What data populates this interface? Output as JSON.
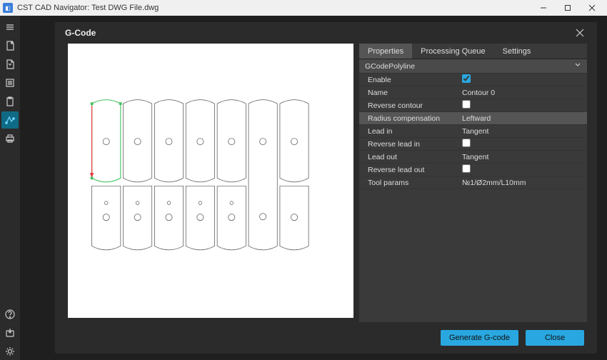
{
  "window": {
    "title": "CST CAD Navigator: Test DWG File.dwg"
  },
  "dialog": {
    "title": "G-Code",
    "tabs": {
      "properties": "Properties",
      "queue": "Processing Queue",
      "settings": "Settings"
    },
    "group_header": "GCodePolyline",
    "props": {
      "enable": {
        "label": "Enable",
        "checked": true
      },
      "name": {
        "label": "Name",
        "value": "Contour 0"
      },
      "reverse_contour": {
        "label": "Reverse contour",
        "checked": false
      },
      "radius_comp": {
        "label": "Radius compensation",
        "value": "Leftward"
      },
      "lead_in": {
        "label": "Lead in",
        "value": "Tangent"
      },
      "reverse_lead_in": {
        "label": "Reverse lead in",
        "checked": false
      },
      "lead_out": {
        "label": "Lead out",
        "value": "Tangent"
      },
      "reverse_lead_out": {
        "label": "Reverse lead out",
        "checked": false
      },
      "tool_params": {
        "label": "Tool params",
        "value": "№1/Ø2mm/L10mm"
      }
    },
    "buttons": {
      "generate": "Generate G-code",
      "close": "Close"
    }
  },
  "icons": {
    "menu": "menu-icon",
    "file": "file-icon",
    "folder": "folder-icon",
    "clipboard": "clipboard-icon",
    "gcode": "gcode-icon",
    "toolpath": "toolpath-icon",
    "printer": "printer-icon",
    "help": "help-icon",
    "save": "save-icon",
    "settings": "settings-icon"
  }
}
